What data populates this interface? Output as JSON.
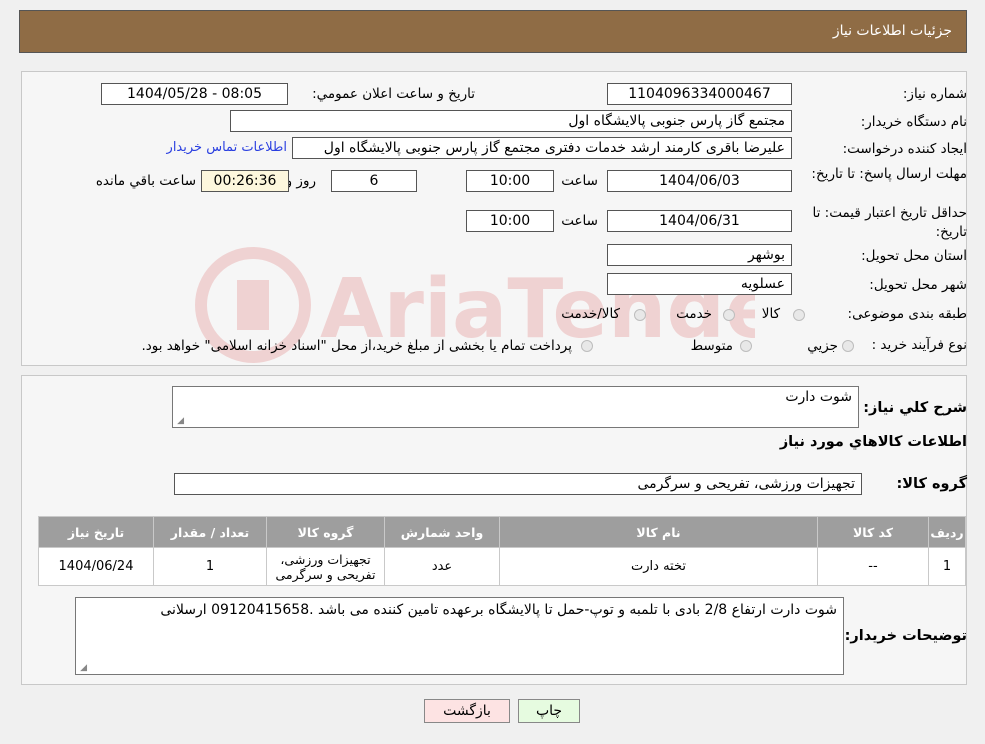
{
  "header": {
    "title": "جزئیات اطلاعات نیاز"
  },
  "form": {
    "need_number_label": "شماره نیاز:",
    "need_number": "1104096334000467",
    "announce_label": "تاریخ و ساعت اعلان عمومي:",
    "announce_value": "1404/05/28 - 08:05",
    "buyer_label": "نام دستگاه خریدار:",
    "buyer_value": "مجتمع گاز پارس جنوبی  پالایشگاه اول",
    "creator_label": "ایجاد کننده درخواست:",
    "creator_value": "علیرضا باقری کارمند ارشد خدمات دفتری مجتمع گاز پارس جنوبی  پالایشگاه اول",
    "contact_link": "اطلاعات تماس خریدار",
    "reply_deadline_label": "مهلت ارسال پاسخ: تا تاریخ:",
    "reply_date": "1404/06/03",
    "time_label": "ساعت",
    "reply_time": "10:00",
    "days_value": "6",
    "days_label": "روز و",
    "remaining_time": "00:26:36",
    "remaining_label": "ساعت باقي مانده",
    "validity_label": "حداقل تاریخ اعتبار قیمت: تا تاریخ:",
    "validity_date": "1404/06/31",
    "validity_time": "10:00",
    "province_label": "استان محل تحویل:",
    "province_value": "بوشهر",
    "city_label": "شهر محل تحویل:",
    "city_value": "عسلویه",
    "category_label": "طبقه بندی موضوعی:",
    "category_options": [
      "کالا",
      "خدمت",
      "کالا/خدمت"
    ],
    "process_label": "نوع فرآیند خرید :",
    "process_options": [
      "جزیي",
      "متوسط"
    ],
    "process_note": "پرداخت تمام یا بخشی از مبلغ خرید،از محل \"اسناد خزانه اسلامی\" خواهد بود."
  },
  "details": {
    "summary_label": "شرح کلي نیاز:",
    "summary_value": "شوت دارت",
    "goods_info_title": "اطلاعات کالاهاي مورد نیاز",
    "group_label": "گروه کالا:",
    "group_value": "تجهیزات ورزشی، تفریحی و سرگرمی",
    "table": {
      "headers": [
        "ردیف",
        "کد کالا",
        "نام کالا",
        "واحد شمارش",
        "گروه کالا",
        "تعداد / مقدار",
        "تاریخ نیاز"
      ],
      "rows": [
        [
          "1",
          "--",
          "تخته دارت",
          "عدد",
          "تجهیزات ورزشی، تفریحی و سرگرمی",
          "1",
          "1404/06/24"
        ]
      ]
    },
    "buyer_notes_label": "توضیحات خریدار:",
    "buyer_notes_value": "شوت دارت ارتفاع 2/8 بادی با تلمبه و توپ-حمل تا پالایشگاه برعهده تامین کننده می باشد .09120415658 ارسلانی"
  },
  "buttons": {
    "print": "چاپ",
    "back": "بازگشت"
  },
  "colors": {
    "header_bg": "#8f6c45",
    "table_header_bg": "#9e9e9e",
    "link": "#2a3fe0",
    "back_btn": "#fde3e3",
    "print_btn": "#e6fbe0"
  }
}
